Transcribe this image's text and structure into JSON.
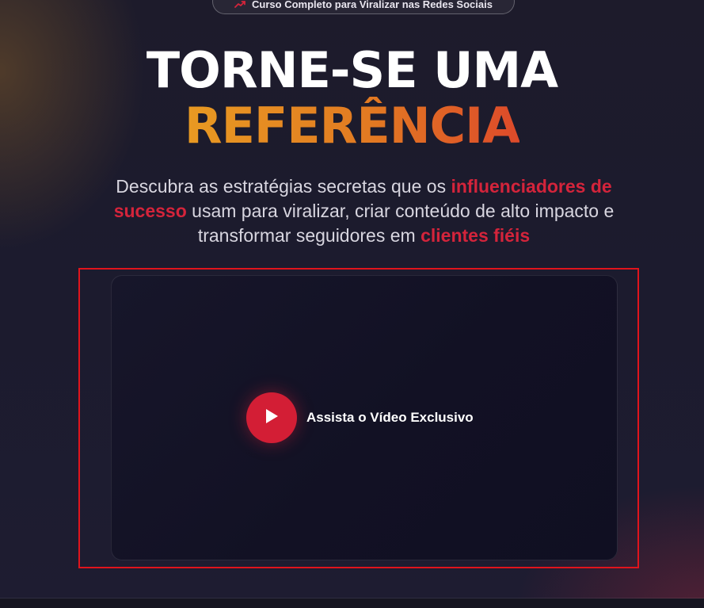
{
  "badge": {
    "icon": "trending-up-icon",
    "text": "Curso Completo para Viralizar nas Redes Sociais"
  },
  "hero": {
    "title_line1": "TORNE-SE UMA",
    "title_line2": "REFERÊNCIA",
    "subtitle_parts": {
      "p1": "Descubra as estratégias secretas que os ",
      "h1": "influenciadores de sucesso",
      "p2": " usam para viralizar, criar conteúdo de alto impacto e transformar seguidores em ",
      "h2": "clientes fiéis"
    }
  },
  "video": {
    "play_icon": "play-icon",
    "label": "Assista o Vídeo Exclusivo"
  },
  "colors": {
    "accent_red": "#d4243b",
    "title_gradient_start": "#e89a22",
    "title_gradient_end": "#dd4a2a",
    "background": "#1c1b2e",
    "outline": "#e0141c"
  }
}
